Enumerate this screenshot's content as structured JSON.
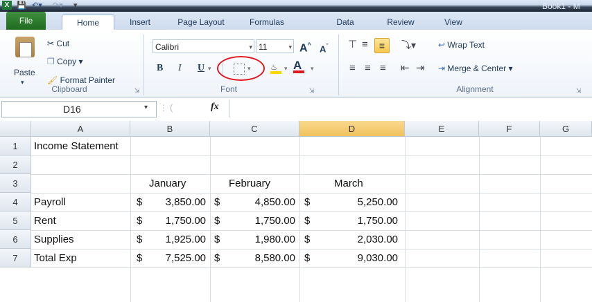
{
  "window": {
    "title": "Book1 - M"
  },
  "quick_access": {
    "save_icon": "save-icon",
    "undo": "undo-icon",
    "redo": "redo-icon"
  },
  "tabs": [
    "File",
    "Home",
    "Insert",
    "Page Layout",
    "Formulas",
    "Data",
    "Review",
    "View"
  ],
  "clipboard": {
    "paste": "Paste",
    "cut": "Cut",
    "copy": "Copy",
    "format_painter": "Format Painter",
    "label": "Clipboard"
  },
  "font": {
    "family": "Calibri",
    "size": "11",
    "bold": "B",
    "italic": "I",
    "underline": "U",
    "label": "Font",
    "grow": "A",
    "shrink": "A",
    "font_color": "A"
  },
  "alignment": {
    "wrap_text": "Wrap Text",
    "merge_center": "Merge & Center",
    "label": "Alignment"
  },
  "formula_bar": {
    "cell_ref": "D16",
    "fx": "fx",
    "value": ""
  },
  "columns": [
    "A",
    "B",
    "C",
    "D",
    "E",
    "F",
    "G"
  ],
  "selected_column": "D",
  "rows": [
    {
      "n": "1",
      "a": "Income Statement",
      "b_cur": "",
      "b": "",
      "c_cur": "",
      "c": "",
      "d_cur": "",
      "d": ""
    },
    {
      "n": "2",
      "a": "",
      "b_cur": "",
      "b": "",
      "c_cur": "",
      "c": "",
      "d_cur": "",
      "d": ""
    },
    {
      "n": "3",
      "a": "",
      "b_cur": "",
      "b": "January",
      "c_cur": "",
      "c": "February",
      "d_cur": "",
      "d": "March"
    },
    {
      "n": "4",
      "a": "Payroll",
      "b_cur": "$",
      "b": "3,850.00",
      "c_cur": "$",
      "c": "4,850.00",
      "d_cur": "$",
      "d": "5,250.00"
    },
    {
      "n": "5",
      "a": "Rent",
      "b_cur": "$",
      "b": "1,750.00",
      "c_cur": "$",
      "c": "1,750.00",
      "d_cur": "$",
      "d": "1,750.00"
    },
    {
      "n": "6",
      "a": "Supplies",
      "b_cur": "$",
      "b": "1,925.00",
      "c_cur": "$",
      "c": "1,980.00",
      "d_cur": "$",
      "d": "2,030.00"
    },
    {
      "n": "7",
      "a": "Total Exp",
      "b_cur": "$",
      "b": "7,525.00",
      "c_cur": "$",
      "c": "8,580.00",
      "d_cur": "$",
      "d": "9,030.00"
    }
  ],
  "colors": {
    "file_tab": "#2d7d2d",
    "highlight_circle": "#e0191f",
    "selected_header": "#f4c866"
  }
}
